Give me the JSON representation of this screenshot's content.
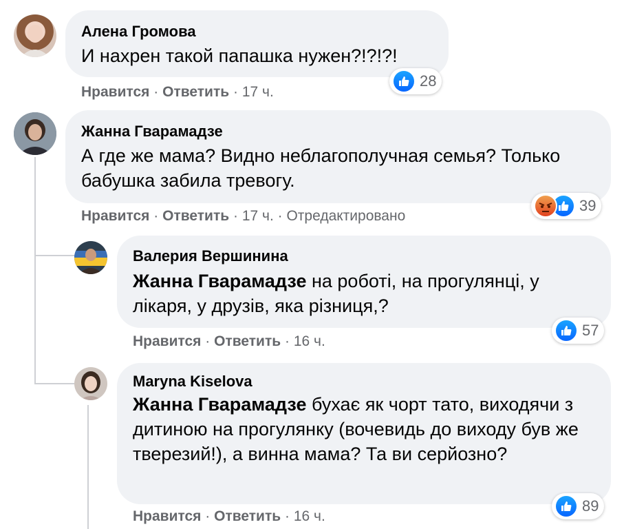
{
  "comments": [
    {
      "author": "Алена Громова",
      "text": "И нахрен такой папашка нужен?!?!?!",
      "actions": {
        "like": "Нравится",
        "reply": "Ответить",
        "time": "17 ч."
      },
      "reactions": {
        "icons": [
          "like-icon"
        ],
        "count": "28"
      }
    },
    {
      "author": "Жанна Гварамадзе",
      "text": "А где же мама? Видно неблагополучная семья? Только бабушка забила тревогу.",
      "actions": {
        "like": "Нравится",
        "reply": "Ответить",
        "time": "17 ч.",
        "edited": "Отредактировано"
      },
      "reactions": {
        "icons": [
          "angry-icon",
          "like-icon"
        ],
        "count": "39"
      }
    }
  ],
  "replies": [
    {
      "author": "Валерия Вершинина",
      "mention": "Жанна Гварамадзе",
      "text": "на роботі, на прогулянці, у лікаря, у друзів, яка різниця,?",
      "actions": {
        "like": "Нравится",
        "reply": "Ответить",
        "time": "16 ч."
      },
      "reactions": {
        "icons": [
          "like-icon"
        ],
        "count": "57"
      }
    },
    {
      "author": "Maryna Kiselova",
      "mention": "Жанна Гварамадзе",
      "text": "бухає як чорт тато, виходячи з дитиною на прогулянку (вочевидь до виходу був же тверезий!), а винна мама? Та ви серйозно?",
      "actions": {
        "like": "Нравится",
        "reply": "Ответить",
        "time": "16 ч."
      },
      "reactions": {
        "icons": [
          "like-icon"
        ],
        "count": "89"
      }
    }
  ],
  "separator": " · ",
  "colors": {
    "bubble": "#f0f2f5",
    "like": "#0866ff",
    "meta": "#65676b"
  }
}
